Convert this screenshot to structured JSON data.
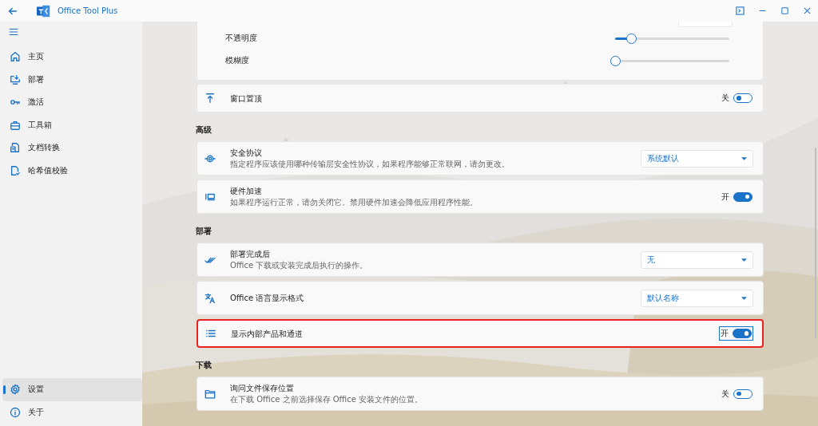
{
  "window": {
    "title": "Office Tool Plus"
  },
  "sidebar": {
    "items": [
      {
        "label": "主页",
        "selected": false
      },
      {
        "label": "部署",
        "selected": false
      },
      {
        "label": "激活",
        "selected": false
      },
      {
        "label": "工具箱",
        "selected": false
      },
      {
        "label": "文档转换",
        "selected": false
      },
      {
        "label": "哈希值校验",
        "selected": false
      }
    ],
    "footer_items": [
      {
        "label": "设置",
        "selected": true
      },
      {
        "label": "关于",
        "selected": false
      }
    ]
  },
  "appearance_card": {
    "sliders": [
      {
        "label": "不透明度",
        "level": 0.13
      },
      {
        "label": "模糊度",
        "level": 0
      }
    ]
  },
  "sections": [
    {
      "cards": [
        {
          "title": "窗口置顶",
          "highlighted": false,
          "control": {
            "kind": "toggle",
            "on": false,
            "label": "关"
          }
        }
      ]
    },
    {
      "heading": "高级",
      "cards": [
        {
          "title": "安全协议",
          "description": "指定程序应该使用哪种传输层安全性协议，如果程序能够正常联网，请勿更改。",
          "highlighted": false,
          "control": {
            "kind": "dropdown",
            "value": "系统默认"
          }
        },
        {
          "title": "硬件加速",
          "description": "如果程序运行正常，请勿关闭它。禁用硬件加速会降低应用程序性能。",
          "highlighted": false,
          "control": {
            "kind": "toggle",
            "on": true,
            "label": "开"
          }
        }
      ]
    },
    {
      "heading": "部署",
      "cards": [
        {
          "title": "部署完成后",
          "description": "Office 下载或安装完成后执行的操作。",
          "highlighted": false,
          "control": {
            "kind": "dropdown",
            "value": "无"
          }
        },
        {
          "title": "Office 语言显示格式",
          "highlighted": false,
          "control": {
            "kind": "dropdown",
            "value": "默认名称"
          }
        },
        {
          "title": "显示内部产品和通道",
          "highlighted": true,
          "control": {
            "kind": "toggle",
            "on": true,
            "label": "开"
          }
        }
      ]
    },
    {
      "heading": "下载",
      "cards": [
        {
          "title": "询问文件保存位置",
          "description": "在下载 Office 之前选择保存 Office 安装文件的位置。",
          "highlighted": false,
          "control": {
            "kind": "toggle",
            "on": false,
            "label": "关"
          }
        }
      ]
    }
  ]
}
